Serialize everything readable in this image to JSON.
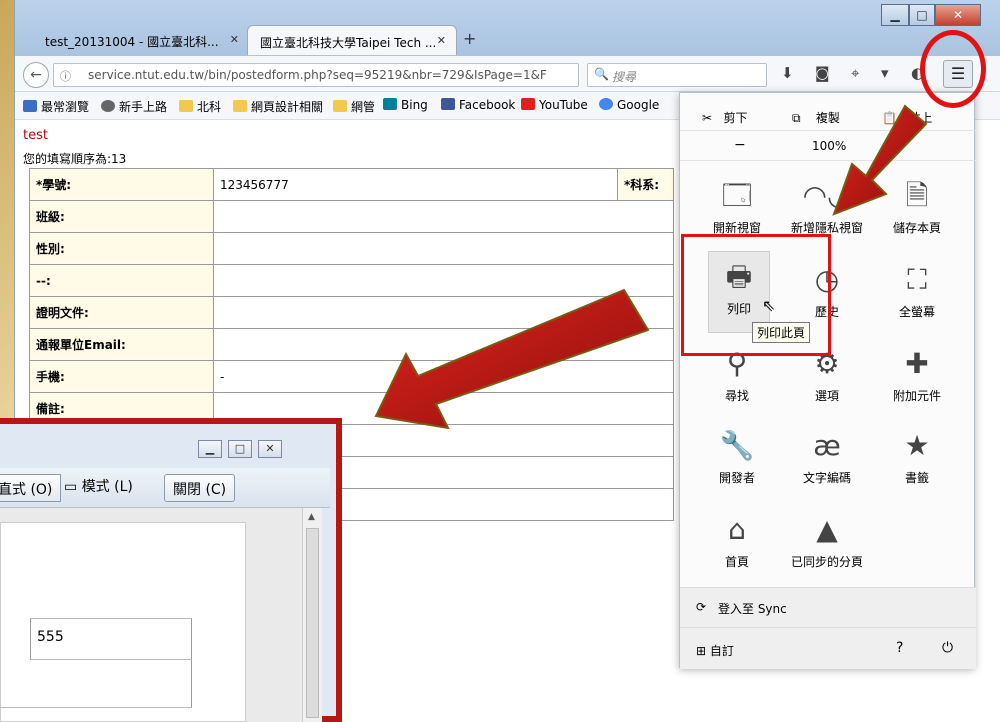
{
  "browser": {
    "tabs": [
      {
        "label": "test_20131004 - 國立臺北科...",
        "active": false
      },
      {
        "label": "國立臺北科技大學Taipei Tech ...",
        "active": true
      }
    ],
    "url": "service.ntut.edu.tw/bin/postedform.php?seq=95219&nbr=729&IsPage=1&F",
    "search_placeholder": "搜尋",
    "bookmarks": [
      {
        "label": "最常瀏覽",
        "color": "#3b6fc2"
      },
      {
        "label": "新手上路",
        "color": "#666666"
      },
      {
        "label": "北科",
        "color": "#f2c94c"
      },
      {
        "label": "網頁設計相關",
        "color": "#f2c94c"
      },
      {
        "label": "網管",
        "color": "#f2c94c"
      },
      {
        "label": "Bing",
        "color": "#00809d"
      },
      {
        "label": "Facebook",
        "color": "#3b5998"
      },
      {
        "label": "YouTube",
        "color": "#e02020"
      },
      {
        "label": "Google",
        "color": "#4285f4"
      }
    ]
  },
  "page": {
    "title": "test",
    "order_text": "您的填寫順序為:13",
    "rows": [
      {
        "label": "*學號:",
        "value": "123456777",
        "extra_label": "*科系:"
      },
      {
        "label": "班級:",
        "value": ""
      },
      {
        "label": "性別:",
        "value": ""
      },
      {
        "label": "--:",
        "value": ""
      },
      {
        "label": "證明文件:",
        "value": ""
      },
      {
        "label": "通報單位Email:",
        "value": ""
      },
      {
        "label": "手機:",
        "value": "-"
      },
      {
        "label": "備註:",
        "value": ""
      }
    ]
  },
  "preview": {
    "mode_btn": "直式 (O)",
    "mode2_btn": "模式 (L)",
    "close_btn": "關閉 (C)",
    "cell_value": "555"
  },
  "menu": {
    "cut": "剪下",
    "copy": "複製",
    "paste": "貼上",
    "zoom_minus": "−",
    "zoom": "100%",
    "items": [
      {
        "label": "開新視窗",
        "icon": "window-icon"
      },
      {
        "label": "新增隱私視窗",
        "icon": "mask-icon"
      },
      {
        "label": "儲存本頁",
        "icon": "page-icon"
      },
      {
        "label": "列印",
        "icon": "printer-icon"
      },
      {
        "label": "歷史",
        "icon": "history-icon"
      },
      {
        "label": "全螢幕",
        "icon": "fullscreen-icon"
      },
      {
        "label": "尋找",
        "icon": "magnifier-icon"
      },
      {
        "label": "選項",
        "icon": "gear-icon"
      },
      {
        "label": "附加元件",
        "icon": "puzzle-icon"
      },
      {
        "label": "開發者",
        "icon": "wrench-icon"
      },
      {
        "label": "文字編碼",
        "icon": "encoding-icon"
      },
      {
        "label": "書籤",
        "icon": "star-icon"
      },
      {
        "label": "首頁",
        "icon": "home-icon"
      },
      {
        "label": "已同步的分頁",
        "icon": "synced-tabs-icon"
      }
    ],
    "tooltip": "列印此頁",
    "signin": "登入至 Sync",
    "customize": "自訂"
  }
}
